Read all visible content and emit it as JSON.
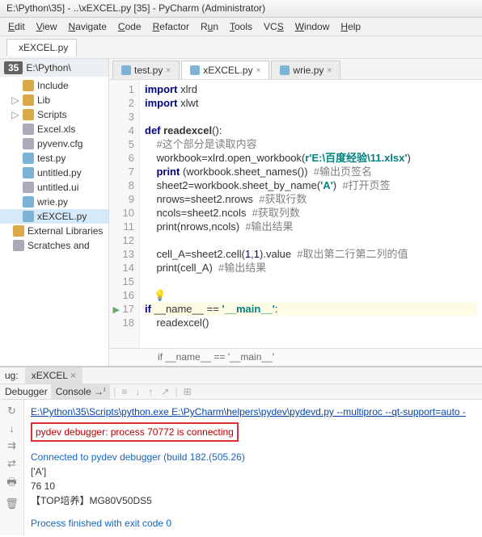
{
  "title": "E:\\Python\\35] - ..\\xEXCEL.py [35] - PyCharm (Administrator)",
  "menu": {
    "edit": "Edit",
    "view": "View",
    "navigate": "Navigate",
    "code": "Code",
    "refactor": "Refactor",
    "run": "Run",
    "tools": "Tools",
    "vcs": "VCS",
    "window": "Window",
    "help": "Help"
  },
  "topTab": "xEXCEL.py",
  "sidebar": {
    "badge": "35",
    "rootPath": "E:\\Python\\",
    "items": [
      {
        "exp": "",
        "icon": "folder",
        "label": "Include"
      },
      {
        "exp": "▷",
        "icon": "folder",
        "label": "Lib"
      },
      {
        "exp": "▷",
        "icon": "folder",
        "label": "Scripts"
      },
      {
        "exp": "",
        "icon": "file",
        "label": "Excel.xls"
      },
      {
        "exp": "",
        "icon": "file",
        "label": "pyvenv.cfg"
      },
      {
        "exp": "",
        "icon": "py",
        "label": "test.py"
      },
      {
        "exp": "",
        "icon": "py",
        "label": "untitled.py"
      },
      {
        "exp": "",
        "icon": "file",
        "label": "untitled.ui"
      },
      {
        "exp": "",
        "icon": "py",
        "label": "wrie.py"
      },
      {
        "exp": "",
        "icon": "py",
        "label": "xEXCEL.py",
        "sel": true
      },
      {
        "exp": "",
        "icon": "folder",
        "label": "External Libraries",
        "ext": true
      },
      {
        "exp": "",
        "icon": "file",
        "label": "Scratches and",
        "ext": true
      }
    ]
  },
  "editorTabs": [
    {
      "label": "test.py",
      "active": false
    },
    {
      "label": "xEXCEL.py",
      "active": true
    },
    {
      "label": "wrie.py",
      "active": false
    }
  ],
  "code": {
    "l1a": "import",
    "l1b": " xlrd",
    "l2a": "import",
    "l2b": " xlwt",
    "l4a": "def ",
    "l4b": "readexcel",
    "l4c": "():",
    "l5": "    #这个部分是读取内容",
    "l6a": "    workbook=xlrd.open_workbook(",
    "l6b": "r'E:\\百度经验\\11.xlsx'",
    "l6c": ")",
    "l7a": "    print",
    "l7b": " (workbook.sheet_names())  ",
    "l7c": "#输出页签名",
    "l8a": "    sheet2=workbook.sheet_by_name(",
    "l8b": "'A'",
    "l8c": ")  ",
    "l8d": "#打开页签",
    "l9a": "    nrows=sheet2.nrows  ",
    "l9b": "#获取行数",
    "l10a": "    ncols=sheet2.ncols  ",
    "l10b": "#获取列数",
    "l11a": "    print(nrows,ncols)  ",
    "l11b": "#输出结果",
    "l13a": "    cell_A=sheet2.cell(",
    "l13b": "1",
    "l13c": ",",
    "l13d": "1",
    "l13e": ").value  ",
    "l13f": "#取出第二行第二列的值",
    "l14a": "    print(cell_A)  ",
    "l14b": "#输出结果",
    "l17a": "if ",
    "l17b": "__name__ == ",
    "l17c": "'__main__'",
    "l17d": ":",
    "l18": "    readexcel()"
  },
  "breadcrumb": "if __name__ == '__main__'",
  "debug": {
    "label": "ug:",
    "tabName": "xEXCEL",
    "subtabs": {
      "debugger": "Debugger",
      "console": "Console →ⁱ"
    },
    "cmd": "E:\\Python\\35\\Scripts\\python.exe E:\\PyCharm\\helpers\\pydev\\pydevd.py --multiproc --qt-support=auto -",
    "highlight": "pydev debugger: process 70772 is connecting",
    "connected": "Connected to pydev debugger (build 182.(505.26)",
    "out1": "['A']",
    "out2": "76 10",
    "out3": "【TOP培养】MG80V50DS5",
    "finished": "Process finished with exit code 0"
  }
}
